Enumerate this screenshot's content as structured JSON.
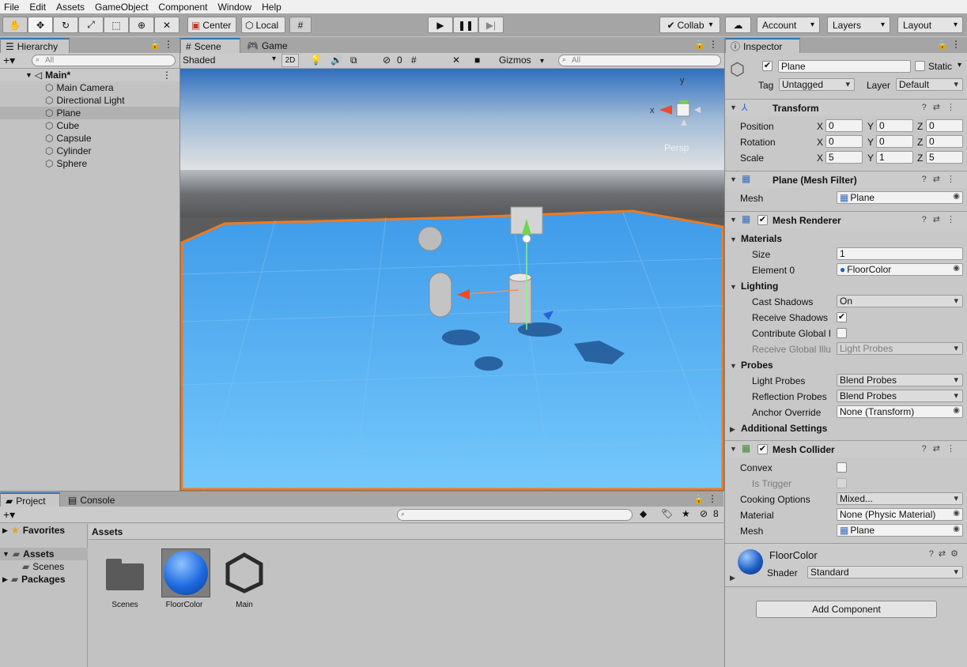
{
  "menu": [
    "File",
    "Edit",
    "Assets",
    "GameObject",
    "Component",
    "Window",
    "Help"
  ],
  "toolbar": {
    "pivot_center": "Center",
    "pivot_local": "Local",
    "collab": "Collab",
    "account": "Account",
    "layers": "Layers",
    "layout": "Layout"
  },
  "hierarchy": {
    "tab": "Hierarchy",
    "search_placeholder": "All",
    "scene": "Main*",
    "items": [
      "Main Camera",
      "Directional Light",
      "Plane",
      "Cube",
      "Capsule",
      "Cylinder",
      "Sphere"
    ],
    "selected": "Plane"
  },
  "scene_view": {
    "tab_scene": "Scene",
    "tab_game": "Game",
    "draw_mode": "Shaded",
    "mode_2d": "2D",
    "hidden_count": "0",
    "gizmos": "Gizmos",
    "search_placeholder": "All",
    "gizmo_y": "y",
    "gizmo_x": "x",
    "persp": "Persp",
    "colors": {
      "sky": "#c9d2de",
      "horizon": "#6c6f73",
      "ground": "#5a5a5a",
      "plane": "#47a6ee",
      "outline": "#f07a1f"
    }
  },
  "inspector": {
    "tab": "Inspector",
    "object_name": "Plane",
    "static_label": "Static",
    "tag_label": "Tag",
    "tag_value": "Untagged",
    "layer_label": "Layer",
    "layer_value": "Default",
    "transform": {
      "title": "Transform",
      "position_label": "Position",
      "position": [
        "0",
        "0",
        "0"
      ],
      "rotation_label": "Rotation",
      "rotation": [
        "0",
        "0",
        "0"
      ],
      "scale_label": "Scale",
      "scale": [
        "5",
        "1",
        "5"
      ],
      "axes": [
        "X",
        "Y",
        "Z"
      ]
    },
    "mesh_filter": {
      "title": "Plane (Mesh Filter)",
      "mesh_label": "Mesh",
      "mesh_value": "Plane"
    },
    "mesh_renderer": {
      "title": "Mesh Renderer",
      "materials": "Materials",
      "size_label": "Size",
      "size_value": "1",
      "element_label": "Element 0",
      "element_value": "FloorColor",
      "lighting": "Lighting",
      "cast_shadows_label": "Cast Shadows",
      "cast_shadows_value": "On",
      "receive_shadows_label": "Receive Shadows",
      "contribute_gi_label": "Contribute Global I",
      "receive_gi_label": "Receive Global Illu",
      "receive_gi_value": "Light Probes",
      "probes": "Probes",
      "light_probes_label": "Light Probes",
      "light_probes_value": "Blend Probes",
      "reflection_probes_label": "Reflection Probes",
      "reflection_probes_value": "Blend Probes",
      "anchor_label": "Anchor Override",
      "anchor_value": "None (Transform)",
      "additional": "Additional Settings"
    },
    "mesh_collider": {
      "title": "Mesh Collider",
      "convex_label": "Convex",
      "trigger_label": "Is Trigger",
      "cooking_label": "Cooking Options",
      "cooking_value": "Mixed...",
      "material_label": "Material",
      "material_value": "None (Physic Material)",
      "mesh_label": "Mesh",
      "mesh_value": "Plane"
    },
    "material": {
      "name": "FloorColor",
      "shader_label": "Shader",
      "shader_value": "Standard"
    },
    "add_component": "Add Component"
  },
  "project": {
    "tab_project": "Project",
    "tab_console": "Console",
    "favorites": "Favorites",
    "assets": "Assets",
    "scenes": "Scenes",
    "packages": "Packages",
    "breadcrumb": "Assets",
    "hidden_count": "8",
    "items": [
      "Scenes",
      "FloorColor",
      "Main"
    ]
  }
}
